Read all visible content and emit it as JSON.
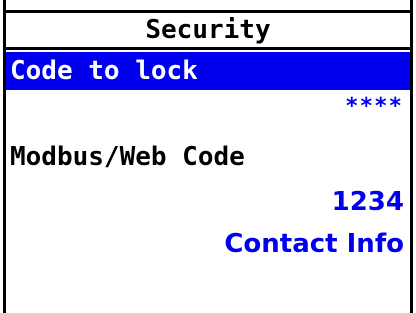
{
  "screen": {
    "title": "Security",
    "items": [
      {
        "label": "Code to lock",
        "value": "****",
        "selected": true
      },
      {
        "label": "Modbus/Web Code",
        "value": "1234",
        "selected": false
      },
      {
        "label": "Contact Info",
        "selected": false
      }
    ]
  },
  "colors": {
    "highlight_bg": "#0000ee",
    "highlight_text": "#ffffff",
    "value_text": "#0000ee",
    "label_text": "#000000",
    "background": "#ffffff"
  }
}
